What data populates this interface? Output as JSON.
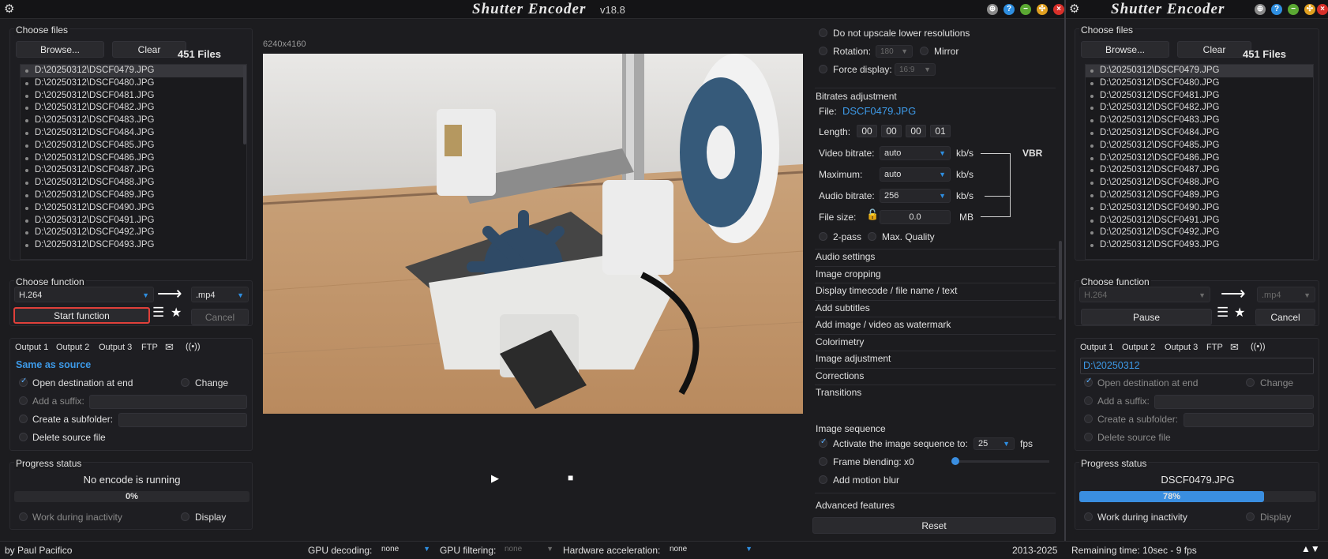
{
  "window": {
    "title": "Shutter Encoder",
    "version": "v18.8",
    "title2": "Shutter Encoder"
  },
  "choose_files": {
    "heading": "Choose files",
    "browse": "Browse...",
    "clear": "Clear",
    "count": "451 Files",
    "files": [
      "D:\\20250312\\DSCF0479.JPG",
      "D:\\20250312\\DSCF0480.JPG",
      "D:\\20250312\\DSCF0481.JPG",
      "D:\\20250312\\DSCF0482.JPG",
      "D:\\20250312\\DSCF0483.JPG",
      "D:\\20250312\\DSCF0484.JPG",
      "D:\\20250312\\DSCF0485.JPG",
      "D:\\20250312\\DSCF0486.JPG",
      "D:\\20250312\\DSCF0487.JPG",
      "D:\\20250312\\DSCF0488.JPG",
      "D:\\20250312\\DSCF0489.JPG",
      "D:\\20250312\\DSCF0490.JPG",
      "D:\\20250312\\DSCF0491.JPG",
      "D:\\20250312\\DSCF0492.JPG",
      "D:\\20250312\\DSCF0493.JPG"
    ]
  },
  "choose_function": {
    "heading": "Choose function",
    "codec": "H.264",
    "ext": ".mp4",
    "start": "Start function",
    "cancel": "Cancel",
    "pause": "Pause"
  },
  "output": {
    "tabs": [
      "Output 1",
      "Output 2",
      "Output 3",
      "FTP"
    ],
    "destination": "Same as source",
    "destination2": "D:\\20250312",
    "open_dest": "Open destination at end",
    "change": "Change",
    "suffix": "Add a suffix:",
    "subfolder": "Create a subfolder:",
    "delete": "Delete source file"
  },
  "progress": {
    "heading": "Progress status",
    "status": "No encode is running",
    "percent": "0%",
    "status2": "DSCF0479.JPG",
    "percent2": "78%",
    "progress2": 0.78,
    "inactivity": "Work during inactivity",
    "display": "Display"
  },
  "preview": {
    "resolution": "6240x4160"
  },
  "right": {
    "no_upscale": "Do not upscale lower resolutions",
    "rotation": "Rotation:",
    "rotation_val": "180",
    "mirror": "Mirror",
    "force_display": "Force display:",
    "force_val": "16:9",
    "bitrates": "Bitrates adjustment",
    "file_label": "File:",
    "file_name": "DSCF0479.JPG",
    "length": "Length:",
    "tc": [
      "00",
      "00",
      "00",
      "01"
    ],
    "video_bitrate": "Video bitrate:",
    "vb_val": "auto",
    "kbs": "kb/s",
    "vbr": "VBR",
    "maximum": "Maximum:",
    "max_val": "auto",
    "audio_bitrate": "Audio bitrate:",
    "ab_val": "256",
    "file_size": "File size:",
    "fs_val": "0.0",
    "mb": "MB",
    "twopass": "2-pass",
    "maxq": "Max. Quality",
    "menu": [
      "Audio settings",
      "Image cropping",
      "Display timecode / file name / text",
      "Add subtitles",
      "Add image / video as watermark",
      "Colorimetry",
      "Image adjustment",
      "Corrections",
      "Transitions"
    ],
    "image_seq": "Image sequence",
    "activate_seq": "Activate the image sequence to:",
    "fps_val": "25",
    "fps": "fps",
    "frame_blend": "Frame blending: x0",
    "motion_blur": "Add motion blur",
    "advanced": "Advanced features",
    "reset": "Reset"
  },
  "statusbar": {
    "author": "by Paul Pacifico",
    "gpu_dec": "GPU decoding:",
    "gpu_dec_val": "none",
    "gpu_filt": "GPU filtering:",
    "gpu_filt_val": "none",
    "hw": "Hardware acceleration:",
    "hw_val": "none",
    "years": "2013-2025",
    "remaining": "Remaining time: 10sec - 9 fps"
  }
}
